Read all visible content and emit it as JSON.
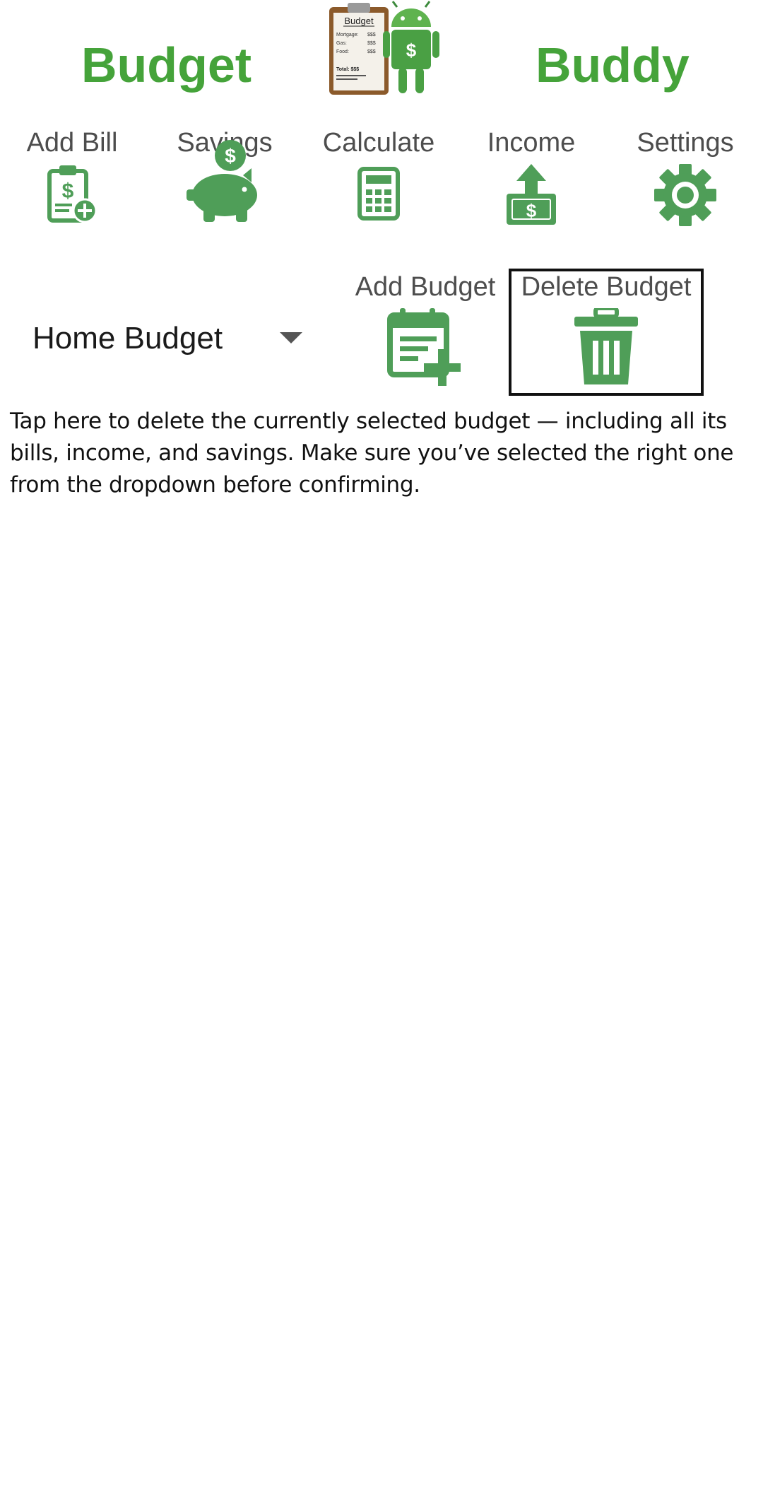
{
  "header": {
    "title_left": "Budget",
    "title_right": "Buddy",
    "logo_clipboard_title": "Budget",
    "logo_lines": [
      {
        "label": "Mortgage:",
        "value": "$$$"
      },
      {
        "label": "Gas:",
        "value": "$$$"
      },
      {
        "label": "Food:",
        "value": "$$$"
      }
    ],
    "logo_total": "Total: $$$",
    "logo_icon": "android-dollar-icon"
  },
  "nav": {
    "items": [
      {
        "label": "Add Bill",
        "icon": "clipboard-dollar-add-icon"
      },
      {
        "label": "Savings",
        "icon": "piggy-bank-icon"
      },
      {
        "label": "Calculate",
        "icon": "calculator-icon"
      },
      {
        "label": "Income",
        "icon": "money-upload-icon"
      },
      {
        "label": "Settings",
        "icon": "gear-icon"
      }
    ]
  },
  "budget_selector": {
    "selected": "Home Budget",
    "icon": "dropdown-caret-icon"
  },
  "actions": {
    "add_budget_label": "Add Budget",
    "add_budget_icon": "calendar-add-icon",
    "delete_budget_label": "Delete Budget",
    "delete_budget_icon": "trash-icon"
  },
  "tooltip": {
    "text": "Tap here to delete the currently selected budget — including all its bills, income, and savings. Make sure you’ve selected the right one from the dropdown before confirming."
  },
  "colors": {
    "brand_green": "#45a33a",
    "icon_green": "#4f9e58",
    "label_gray": "#4d4d4d",
    "highlight_border": "#111111"
  }
}
